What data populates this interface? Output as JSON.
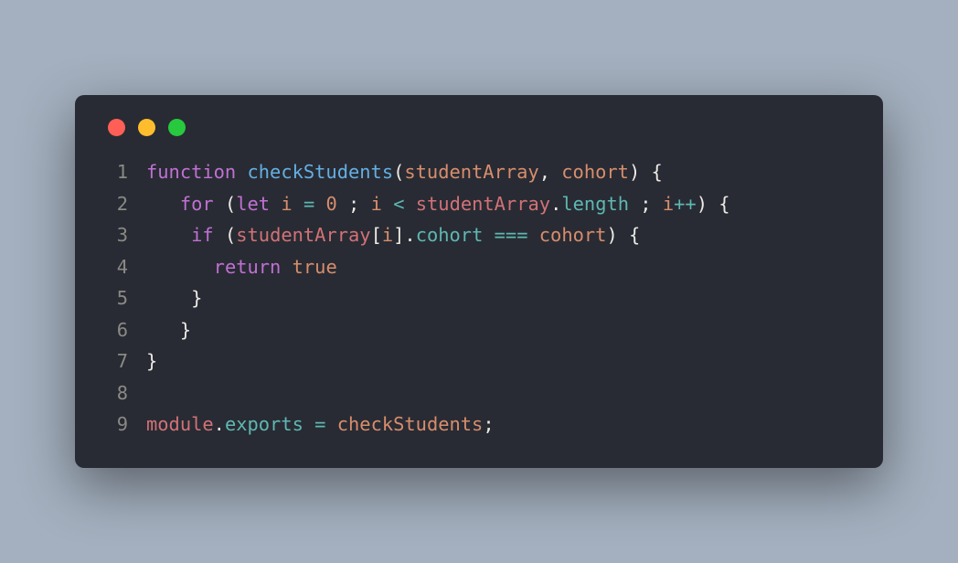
{
  "window": {
    "traffic_colors": {
      "red": "#ff5f56",
      "yellow": "#ffbd2e",
      "green": "#27c93f"
    },
    "background": "#282b33"
  },
  "code": {
    "language": "javascript",
    "lines": [
      {
        "n": "1",
        "tokens": [
          {
            "cls": "kw",
            "t": "function"
          },
          {
            "cls": "punc",
            "t": " "
          },
          {
            "cls": "fn",
            "t": "checkStudents"
          },
          {
            "cls": "punc",
            "t": "("
          },
          {
            "cls": "param",
            "t": "studentArray"
          },
          {
            "cls": "punc",
            "t": ", "
          },
          {
            "cls": "param",
            "t": "cohort"
          },
          {
            "cls": "punc",
            "t": ") {"
          }
        ]
      },
      {
        "n": "2",
        "tokens": [
          {
            "cls": "punc",
            "t": "   "
          },
          {
            "cls": "kw",
            "t": "for"
          },
          {
            "cls": "punc",
            "t": " ("
          },
          {
            "cls": "kw",
            "t": "let"
          },
          {
            "cls": "punc",
            "t": " "
          },
          {
            "cls": "param",
            "t": "i"
          },
          {
            "cls": "punc",
            "t": " "
          },
          {
            "cls": "op",
            "t": "="
          },
          {
            "cls": "punc",
            "t": " "
          },
          {
            "cls": "num",
            "t": "0"
          },
          {
            "cls": "punc",
            "t": " ; "
          },
          {
            "cls": "param",
            "t": "i"
          },
          {
            "cls": "punc",
            "t": " "
          },
          {
            "cls": "op",
            "t": "<"
          },
          {
            "cls": "punc",
            "t": " "
          },
          {
            "cls": "obj",
            "t": "studentArray"
          },
          {
            "cls": "punc",
            "t": "."
          },
          {
            "cls": "tprop",
            "t": "length"
          },
          {
            "cls": "punc",
            "t": " ; "
          },
          {
            "cls": "param",
            "t": "i"
          },
          {
            "cls": "op",
            "t": "++"
          },
          {
            "cls": "punc",
            "t": ") {"
          }
        ]
      },
      {
        "n": "3",
        "tokens": [
          {
            "cls": "punc",
            "t": "    "
          },
          {
            "cls": "kw",
            "t": "if"
          },
          {
            "cls": "punc",
            "t": " ("
          },
          {
            "cls": "obj",
            "t": "studentArray"
          },
          {
            "cls": "punc",
            "t": "["
          },
          {
            "cls": "param",
            "t": "i"
          },
          {
            "cls": "punc",
            "t": "]."
          },
          {
            "cls": "tprop",
            "t": "cohort"
          },
          {
            "cls": "punc",
            "t": " "
          },
          {
            "cls": "op",
            "t": "==="
          },
          {
            "cls": "punc",
            "t": " "
          },
          {
            "cls": "param",
            "t": "cohort"
          },
          {
            "cls": "punc",
            "t": ") {"
          }
        ]
      },
      {
        "n": "4",
        "tokens": [
          {
            "cls": "punc",
            "t": "      "
          },
          {
            "cls": "kw",
            "t": "return"
          },
          {
            "cls": "punc",
            "t": " "
          },
          {
            "cls": "lit",
            "t": "true"
          }
        ]
      },
      {
        "n": "5",
        "tokens": [
          {
            "cls": "punc",
            "t": "    }"
          }
        ]
      },
      {
        "n": "6",
        "tokens": [
          {
            "cls": "punc",
            "t": "   }"
          }
        ]
      },
      {
        "n": "7",
        "tokens": [
          {
            "cls": "punc",
            "t": "}"
          }
        ]
      },
      {
        "n": "8",
        "tokens": []
      },
      {
        "n": "9",
        "tokens": [
          {
            "cls": "obj",
            "t": "module"
          },
          {
            "cls": "punc",
            "t": "."
          },
          {
            "cls": "tprop",
            "t": "exports"
          },
          {
            "cls": "punc",
            "t": " "
          },
          {
            "cls": "op",
            "t": "="
          },
          {
            "cls": "punc",
            "t": " "
          },
          {
            "cls": "param",
            "t": "checkStudents"
          },
          {
            "cls": "punc",
            "t": ";"
          }
        ]
      }
    ]
  }
}
